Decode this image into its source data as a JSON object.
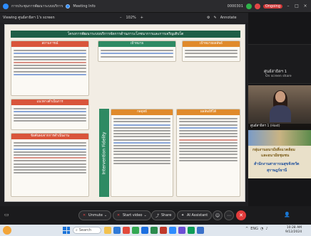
{
  "window": {
    "title": "การประชุมการพัฒนาระบบบริการ",
    "meeting_tab": "Meeting Info",
    "id_label": "0000301",
    "status": "Ongoing",
    "accent": "#2d8cff"
  },
  "viewbar": {
    "viewing": "Viewing ศูนย์สาธิตฯ 1's screen",
    "zoom": "102%",
    "annotate": "Annotate"
  },
  "shared": {
    "heading": "โครงการพัฒนาระบบบริการจัดการด้านภาวะโภชนาการและการเจริญเติบโต",
    "box_titles": [
      "สถานการณ์",
      "เป้าหมาย",
      "เป้าหมายผลลัพธ์",
      "แนวทางดำเนินการ",
      "ข้อค้นพบจากการดำเนินงาน",
      "กลยุทธ์",
      "ผลลัพธ์ที่ได้"
    ],
    "intervention": "Intervention Fidelity",
    "colors": {
      "header": "#1f5e46",
      "red": "#d9553b",
      "orange": "#e08a2b",
      "green": "#2e8a63"
    }
  },
  "sidebar": {
    "participant_name": "ศูนย์สาธิตฯ 1",
    "participant_status": "On screen share",
    "video_label": "ศูนย์สาธิตฯ 1 (Host)",
    "banner_line1": "กลุ่มงานอนามัยสิ่งแวดล้อม",
    "banner_line2": "และอนามัยชุมชน",
    "banner_line3": "สำนักงานสาธารณสุขจังหวัด",
    "banner_line4": "สุราษฎร์ธานี"
  },
  "controls": {
    "unmute": "Unmute",
    "start_video": "Start video",
    "share": "Share",
    "ai_assistant": "AI Assistant"
  },
  "taskbar": {
    "search": "Search",
    "time": "10:28 AM",
    "date": "9/12/2024",
    "lang": "ENG"
  }
}
